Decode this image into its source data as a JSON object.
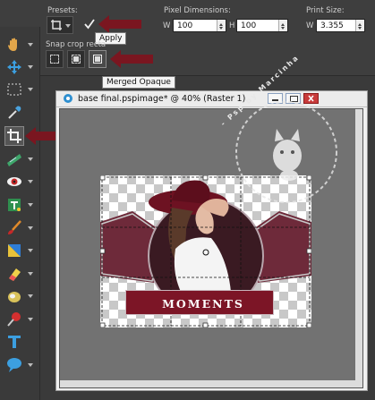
{
  "toolbar": {
    "presets_label": "Presets:",
    "pixel_dimensions_label": "Pixel Dimensions:",
    "print_size_label": "Print Size:",
    "w_label": "W",
    "h_label": "H",
    "pixel_width_value": "100",
    "pixel_height_value": "100",
    "print_w_label": "W",
    "print_width_value": "3.355",
    "snap_crop_label": "Snap crop recta",
    "apply_tooltip": "Apply",
    "merged_opaque_tooltip": "Merged Opaque"
  },
  "document": {
    "title": "base final.pspimage* @  40% (Raster 1)",
    "banner_text": "MOMENTS"
  },
  "watermark": {
    "text": "- Psp by Marcinha"
  },
  "colors": {
    "arrow": "#7a1620",
    "banner": "#7c1526",
    "ui_background": "#3a3a3a"
  },
  "tools": [
    "pan-icon",
    "move-icon",
    "selection-icon",
    "dropper-icon",
    "crop-icon",
    "straighten-icon",
    "red-eye-icon",
    "text-box-icon",
    "paint-brush-icon",
    "gradient-icon",
    "eraser-icon",
    "fill-icon",
    "push-pin-icon",
    "text-icon",
    "speech-bubble-icon"
  ]
}
